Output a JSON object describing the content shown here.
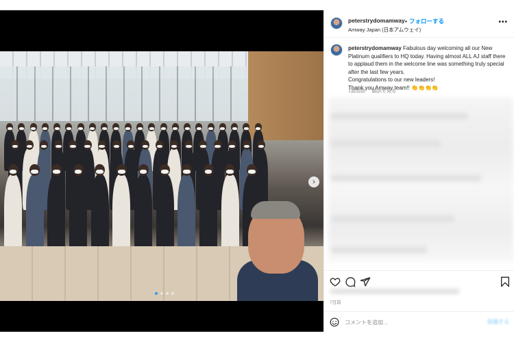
{
  "post": {
    "username": "peterstrydomamway",
    "follow_label": "フォローする",
    "separator": "•",
    "location": "Amway Japan (日本アムウェイ)",
    "more_label": "•••",
    "caption_username": "peterstrydomamway",
    "caption_text": "Fabulous day welcoming all our New Platinum qualifiers to HQ today. Having almost ALL AJ staff there to applaud them in the welcome line was something truly special after the last few years.",
    "caption_line2": "Congratulations to our new leaders!",
    "caption_line3": "Thank you Amway team!! 👏👏👏👏",
    "time_ago": "1週間前",
    "translate_label": "翻訳を見る",
    "date": "7日前",
    "comment_placeholder": "コメントを追加...",
    "post_label": "投稿する"
  },
  "media": {
    "next_icon": "chevron-right-icon",
    "next_glyph": "›",
    "carousel_count": 4,
    "carousel_active": 1
  },
  "icons": {
    "like": "heart-icon",
    "comment": "comment-icon",
    "share": "paper-plane-icon",
    "save": "bookmark-icon",
    "emoji": "smiley-icon"
  },
  "colors": {
    "accent": "#0095f6",
    "text": "#262626",
    "muted": "#8e8e8e"
  }
}
